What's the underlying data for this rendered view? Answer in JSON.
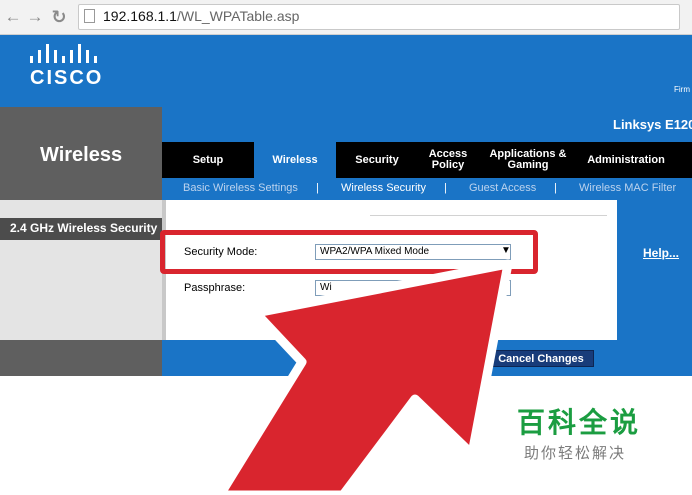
{
  "browser": {
    "url_host": "192.168.1.1",
    "url_path": "/WL_WPATable.asp"
  },
  "header": {
    "brand": "CISCO",
    "firmware_label": "Firm",
    "model": "Linksys E120",
    "section_title": "Wireless"
  },
  "tabs": [
    {
      "label": "Setup",
      "active": false
    },
    {
      "label": "Wireless",
      "active": true
    },
    {
      "label": "Security",
      "active": false
    },
    {
      "label": "Access Policy",
      "active": false
    },
    {
      "label": "Applications & Gaming",
      "active": false
    },
    {
      "label": "Administration",
      "active": false
    }
  ],
  "subnav": [
    {
      "label": "Basic Wireless Settings",
      "current": false
    },
    {
      "label": "Wireless Security",
      "current": true
    },
    {
      "label": "Guest Access",
      "current": false
    },
    {
      "label": "Wireless MAC Filter",
      "current": false
    }
  ],
  "subnav_separator": "|",
  "left": {
    "section_label": "2.4 GHz Wireless Security"
  },
  "form": {
    "security_mode_label": "Security Mode:",
    "security_mode_value": "WPA2/WPA Mixed Mode",
    "passphrase_label": "Passphrase:",
    "passphrase_value": "Wi"
  },
  "help": {
    "link": "Help..."
  },
  "buttons": {
    "save_partial": "ngs",
    "cancel": "Cancel Changes"
  },
  "watermark": {
    "title": "百科全说",
    "subtitle": "助你轻松解决"
  },
  "colors": {
    "cisco_blue": "#1a74c6",
    "annotation_red": "#d9252e",
    "watermark_green": "#1b9d41"
  }
}
